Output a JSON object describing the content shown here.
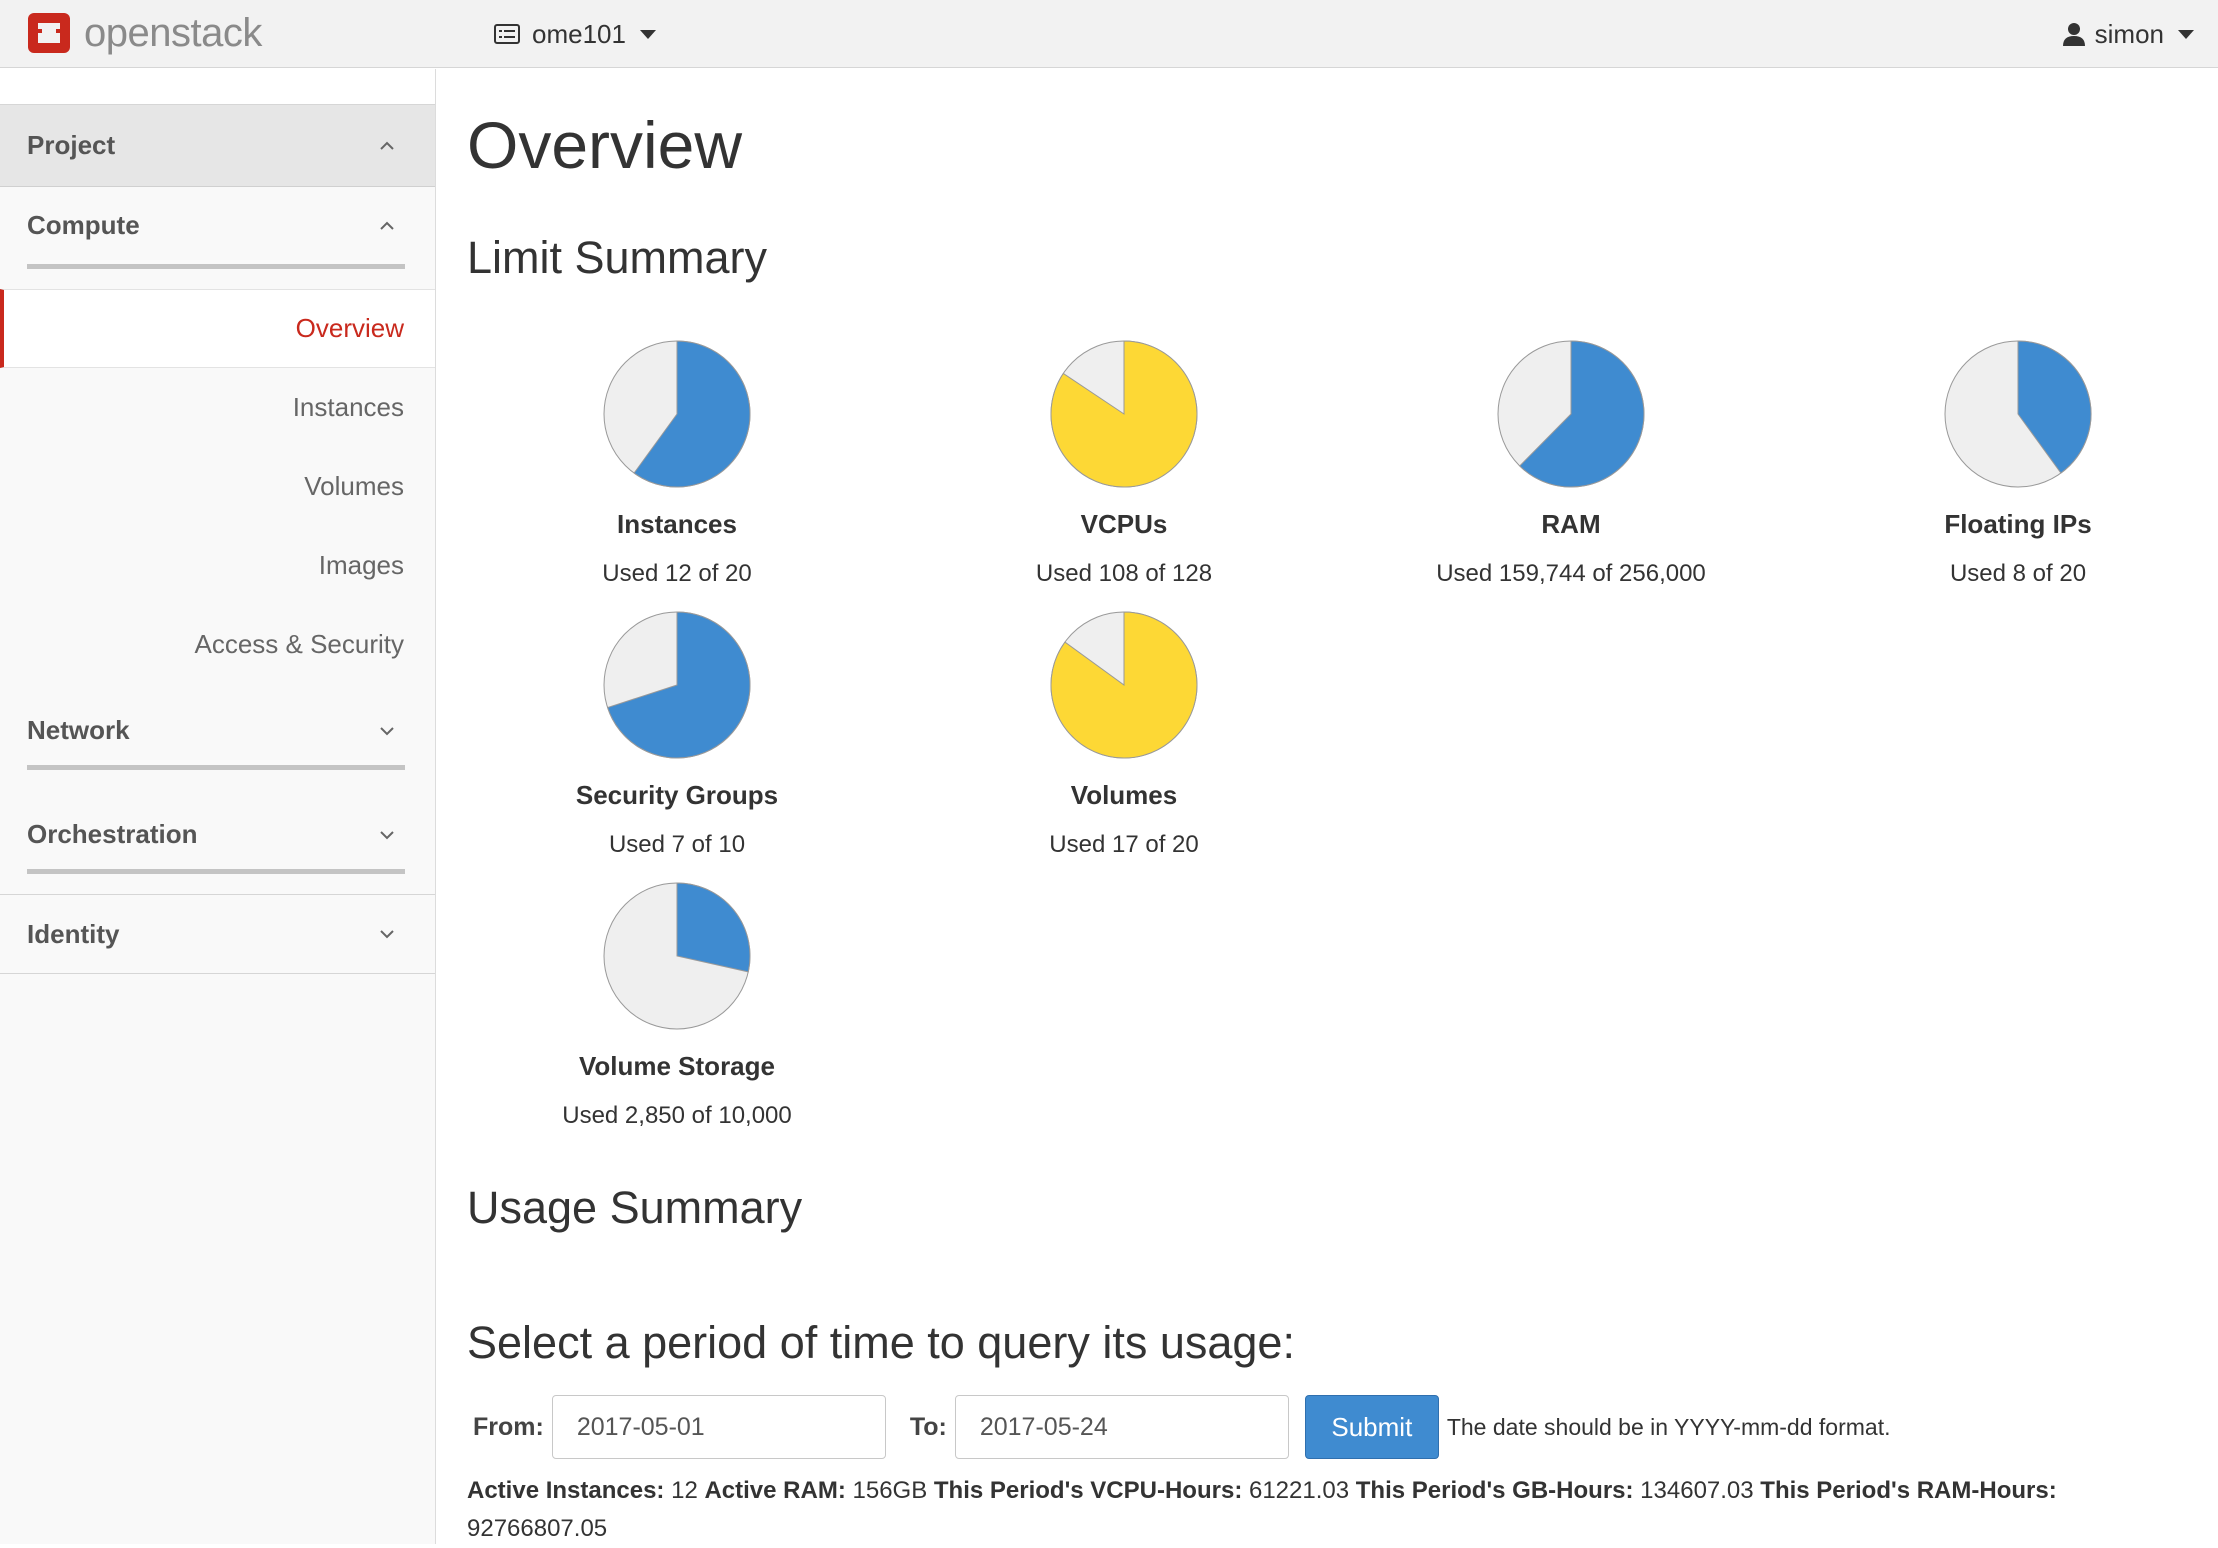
{
  "brand": {
    "name": "openstack",
    "logo_color": "#c9291d"
  },
  "project_switcher": {
    "label": "ome101",
    "icon": "list-icon"
  },
  "user_menu": {
    "label": "simon",
    "icon": "user-icon"
  },
  "sidebar": {
    "project": "Project",
    "compute": "Compute",
    "items": [
      {
        "label": "Overview",
        "active": true
      },
      {
        "label": "Instances"
      },
      {
        "label": "Volumes"
      },
      {
        "label": "Images"
      },
      {
        "label": "Access & Security"
      }
    ],
    "network": "Network",
    "orchestration": "Orchestration",
    "identity": "Identity"
  },
  "main": {
    "title": "Overview",
    "limit_summary": "Limit Summary",
    "usage_summary": "Usage Summary",
    "period_heading": "Select a period of time to query its usage:",
    "from_label": "From:",
    "from_value": "2017-05-01",
    "to_label": "To:",
    "to_value": "2017-05-24",
    "submit": "Submit",
    "date_help": "The date should be in YYYY-mm-dd format.",
    "stats": [
      {
        "label": "Active Instances:",
        "value": "12"
      },
      {
        "label": "Active RAM:",
        "value": "156GB"
      },
      {
        "label": "This Period's VCPU-Hours:",
        "value": "61221.03"
      },
      {
        "label": "This Period's GB-Hours:",
        "value": "134607.03"
      },
      {
        "label": "This Period's RAM-Hours:",
        "value": "92766807.05"
      }
    ]
  },
  "colors": {
    "pie_normal": "#3f8bd0",
    "pie_warning": "#fdd835",
    "pie_empty": "#efefef"
  },
  "chart_data": {
    "type": "pie",
    "limits": [
      {
        "name": "Instances",
        "text": "Used 12 of 20",
        "used": 12,
        "total": 20
      },
      {
        "name": "VCPUs",
        "text": "Used 108 of 128",
        "used": 108,
        "total": 128
      },
      {
        "name": "RAM",
        "text": "Used 159,744 of 256,000",
        "used": 159744,
        "total": 256000
      },
      {
        "name": "Floating IPs",
        "text": "Used 8 of 20",
        "used": 8,
        "total": 20
      },
      {
        "name": "Security Groups",
        "text": "Used 7 of 10",
        "used": 7,
        "total": 10
      },
      {
        "name": "Volumes",
        "text": "Used 17 of 20",
        "used": 17,
        "total": 20
      },
      {
        "name": "Volume Storage",
        "text": "Used 2,850 of 10,000",
        "used": 2850,
        "total": 10000
      }
    ]
  }
}
